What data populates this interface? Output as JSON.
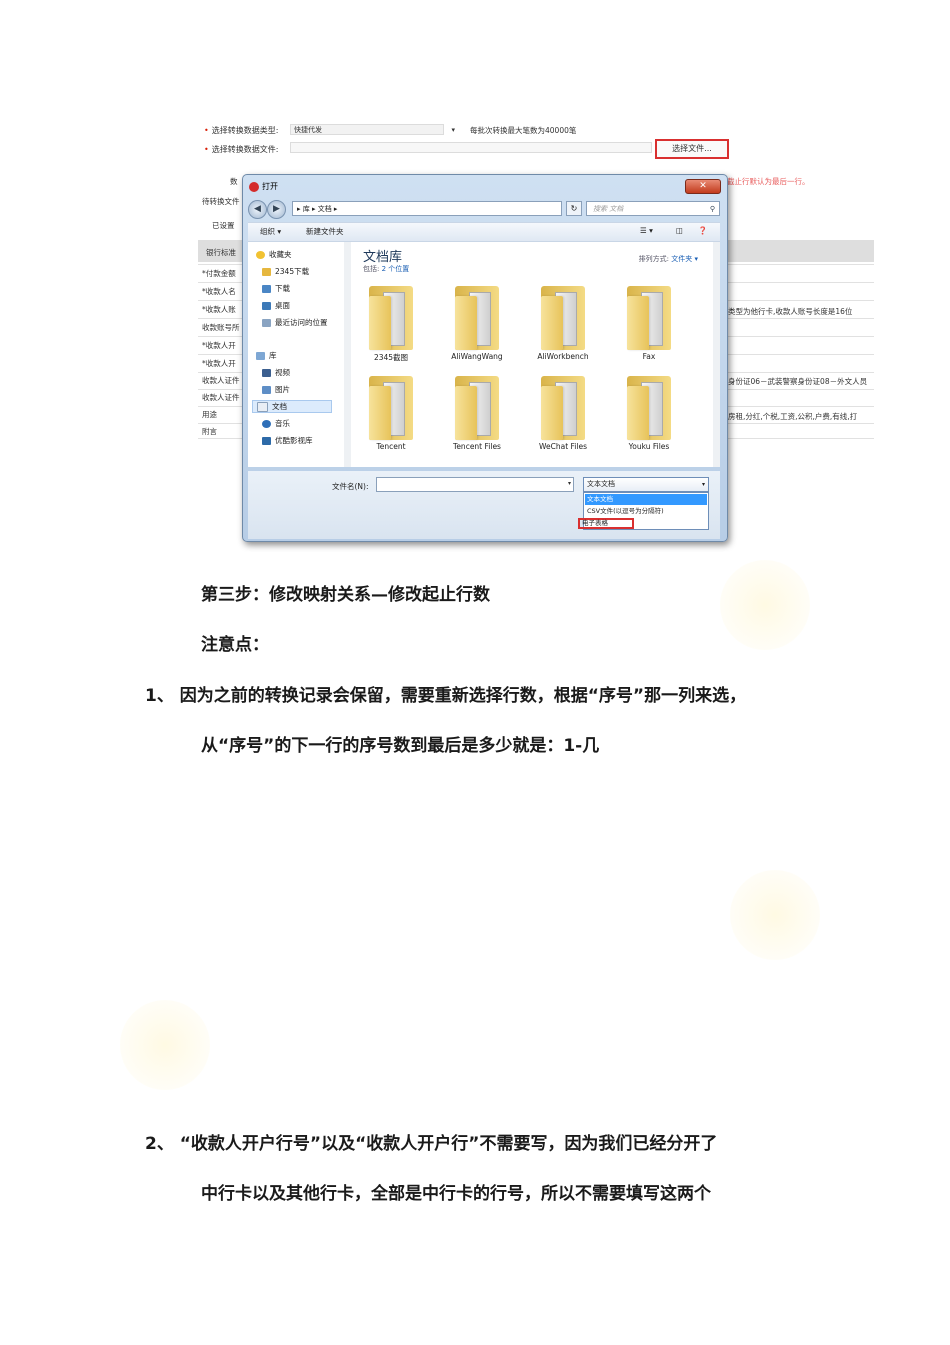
{
  "screenshot": {
    "form": {
      "type_label": "选择转换数据类型:",
      "type_value": "快捷代发",
      "max_note": "每批次转换最大笔数为40000笔",
      "file_label": "选择转换数据文件:",
      "choose_button": "选择文件...",
      "hint_red": "截止行默认为最后一行。",
      "left_fragments": [
        "数",
        "待转换文件",
        "已设置",
        "银行标准",
        "*付款金额",
        "*收款人名",
        "*收款人账",
        "收款账号所",
        "*收款人开",
        "*收款人开",
        "收款人证件",
        "收款人证件",
        "用途",
        "附言"
      ],
      "right_fragments": [
        "类型为他行卡,收款人账号长度是16位",
        "身份证06－武装警察身份证08－外文人员",
        "房租,分红,个税,工资,公积,户费,有线,打"
      ]
    },
    "dialog": {
      "title": "打开",
      "close": "✕",
      "address": "▸ 库 ▸ 文档 ▸",
      "search_placeholder": "搜索 文档",
      "toolbar": {
        "organize": "组织 ▾",
        "new_folder": "新建文件夹"
      },
      "nav": {
        "favorites": "收藏夹",
        "items_fav": [
          "2345下载",
          "下载",
          "桌面",
          "最近访问的位置"
        ],
        "libraries": "库",
        "items_lib": [
          "视频",
          "图片",
          "文档",
          "音乐",
          "优酷影视库"
        ]
      },
      "library_title": "文档库",
      "library_sub_prefix": "包括:",
      "library_sub_link": "2 个位置",
      "arrange_label": "排列方式:",
      "arrange_value": "文件夹 ▾",
      "folders": [
        "2345截图",
        "AliWangWang",
        "AliWorkbench",
        "Fax",
        "Tencent",
        "Tencent Files",
        "WeChat Files",
        "Youku Files"
      ],
      "filename_label": "文件名(N):",
      "filetype_selected": "文本文档",
      "filetype_options": [
        "文本文档",
        "CSV文件(以逗号为分隔符)",
        "电子表格"
      ]
    }
  },
  "text": {
    "step3": "第三步：修改映射关系—修改起止行数",
    "note": "注意点：",
    "item1_line1": "1、 因为之前的转换记录会保留，需要重新选择行数，根据“序号”那一列来选，",
    "item1_line2": "从“序号”的下一行的序号数到最后是多少就是：1-几",
    "item2_line1": "2、 “收款人开户行号”以及“收款人开户行”不需要写，因为我们已经分开了",
    "item2_line2": "中行卡以及其他行卡，全部是中行卡的行号，所以不需要填写这两个"
  }
}
